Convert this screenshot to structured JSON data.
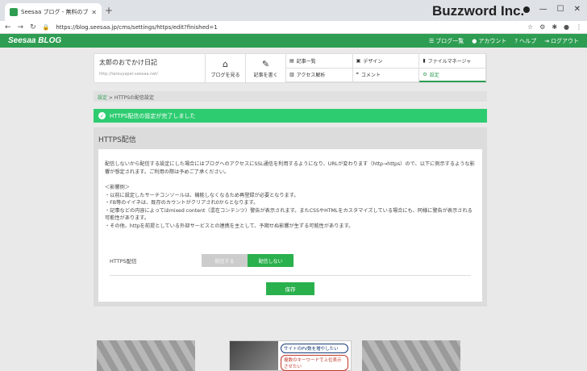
{
  "browser": {
    "tab_title": "Seesaa ブログ - 無料のブログ(blog)",
    "url": "https://blog.seesaa.jp/cms/settings/https/edit?finished=1",
    "brand": "Buzzword Inc."
  },
  "header": {
    "logo": "Seesaa BLOG",
    "nav": [
      "ブログ一覧",
      "アカウント",
      "ヘルプ",
      "ログアウト"
    ]
  },
  "blog": {
    "name": "太郎のおでかけ日記",
    "url": "http://tarouyaper.seesaa.net/",
    "view_label": "ブログを見る",
    "write_label": "記事を書く",
    "menu": [
      "記事一覧",
      "デザイン",
      "ファイルマネージャ",
      "アクセス解析",
      "コメント",
      "設定"
    ]
  },
  "breadcrumb": {
    "parent": "設定",
    "sep": " > ",
    "current": "HTTPSの配信設定"
  },
  "alert": "HTTPS配信の設定が完了しました",
  "panel": {
    "title": "HTTPS配信",
    "intro": "配信しないから配信する設定にした場合にはブログへのアクセスにSSL通信を利用するようになり、URLが変わります（http→https）ので、以下に例示するような影響が想定されます。ご利用の際は予めご了承ください。",
    "impact_heading": "＜影響例＞",
    "impacts": [
      "・以前に設定したサーチコンソールは、機能しなくなるため再登録が必要となります。",
      "・FB等のイイネは、既存のカウントがクリアされ0からとなります。",
      "・記事などの内容によってはmixed content（混在コンテンツ）警告が表示されます。またCSSやHTMLをカスタマイズしている場合にも、同様に警告が表示される可能性があります。",
      "・その他、httpを前提としている外部サービスとの連携を主として、予期せぬ影響が生ずる可能性があります。"
    ],
    "field_label": "HTTPS配信",
    "option_on": "配信する",
    "option_off": "配信しない",
    "save": "保存"
  },
  "ad": {
    "bubble1": "サイトのPV数を増やしたい",
    "bubble2": "複数のキーワードで上位表示させたい"
  }
}
